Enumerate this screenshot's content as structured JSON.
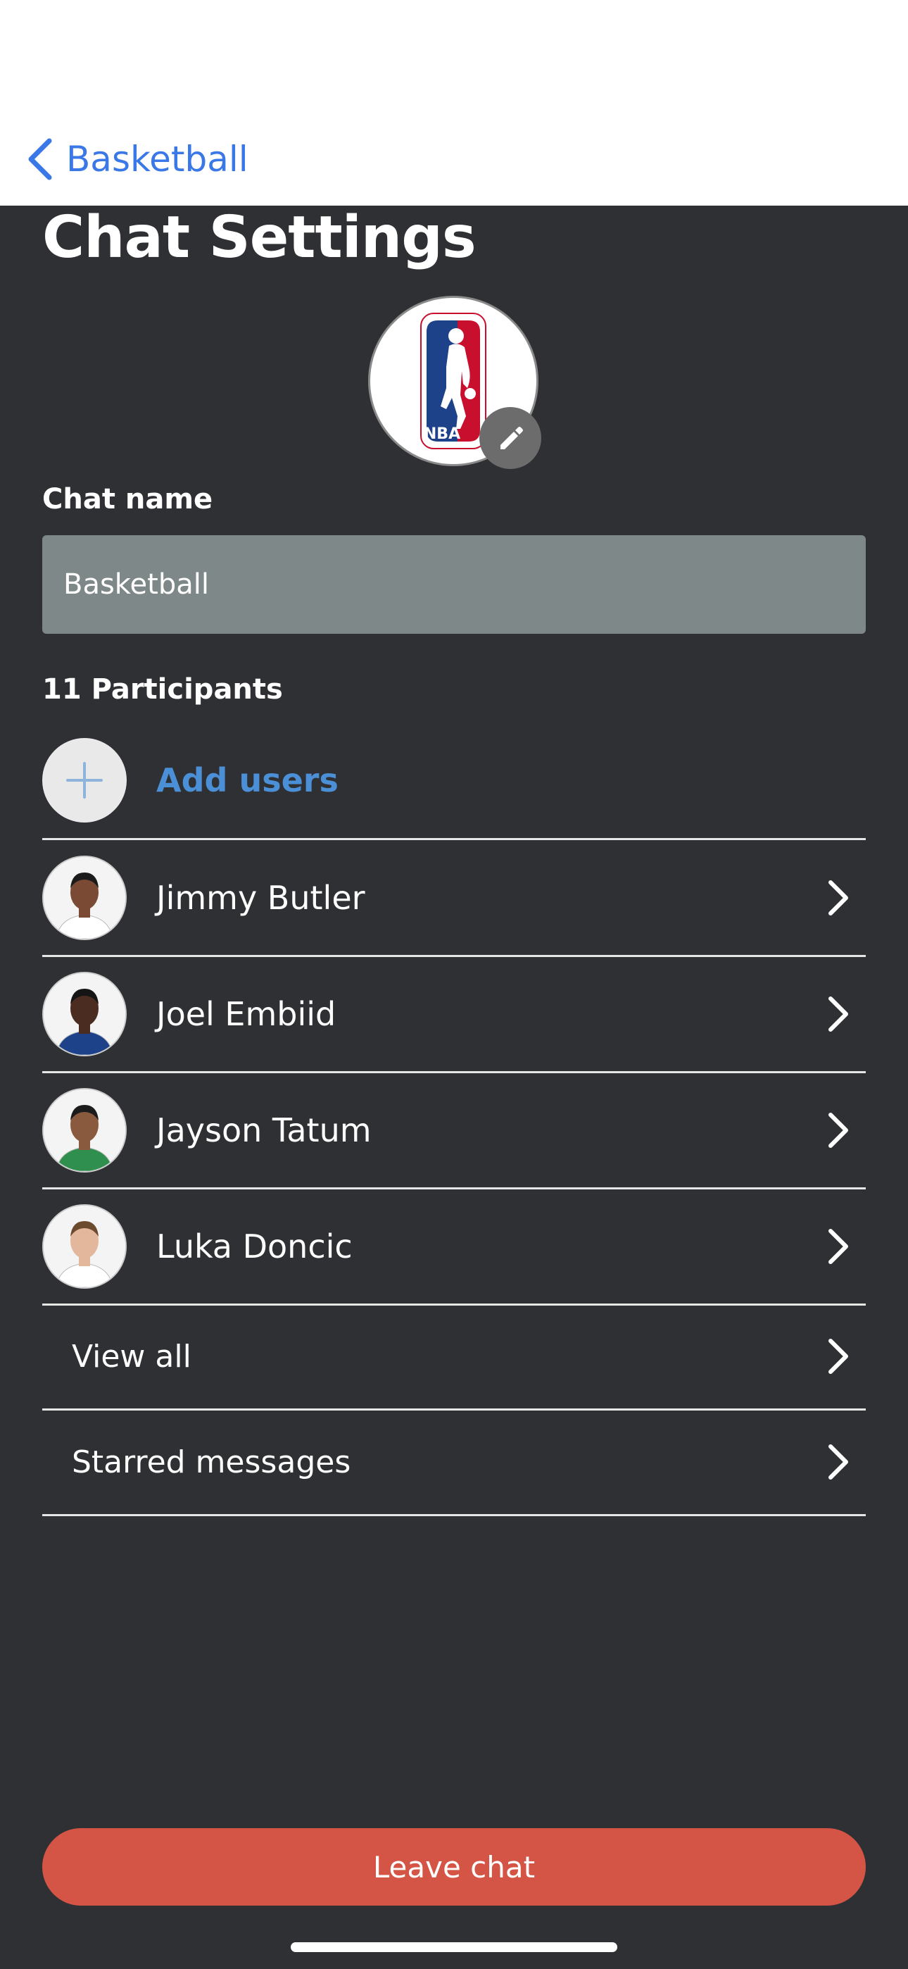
{
  "nav": {
    "back_label": "Basketball"
  },
  "page": {
    "title": "Chat Settings"
  },
  "chat": {
    "name_label": "Chat name",
    "name_value": "Basketball",
    "participants_label": "11 Participants",
    "add_users_label": "Add users",
    "logo_text": "NBA"
  },
  "participants": [
    {
      "name": "Jimmy Butler",
      "jersey": "#ffffff",
      "skin": "#7a4a35",
      "hair": "#1b1b1b"
    },
    {
      "name": "Joel Embiid",
      "jersey": "#1d428a",
      "skin": "#4a2c20",
      "hair": "#151515"
    },
    {
      "name": "Jayson Tatum",
      "jersey": "#2f8f4e",
      "skin": "#8a5a3e",
      "hair": "#1c1c1c"
    },
    {
      "name": "Luka Doncic",
      "jersey": "#ffffff",
      "skin": "#e3b79b",
      "hair": "#6b4a2d"
    }
  ],
  "links": {
    "view_all": "View all",
    "starred": "Starred messages"
  },
  "actions": {
    "leave": "Leave chat"
  },
  "colors": {
    "accent": "#3b78e7",
    "add_users": "#4b8fd6",
    "leave_button": "#d45545",
    "background": "#2f3033"
  }
}
